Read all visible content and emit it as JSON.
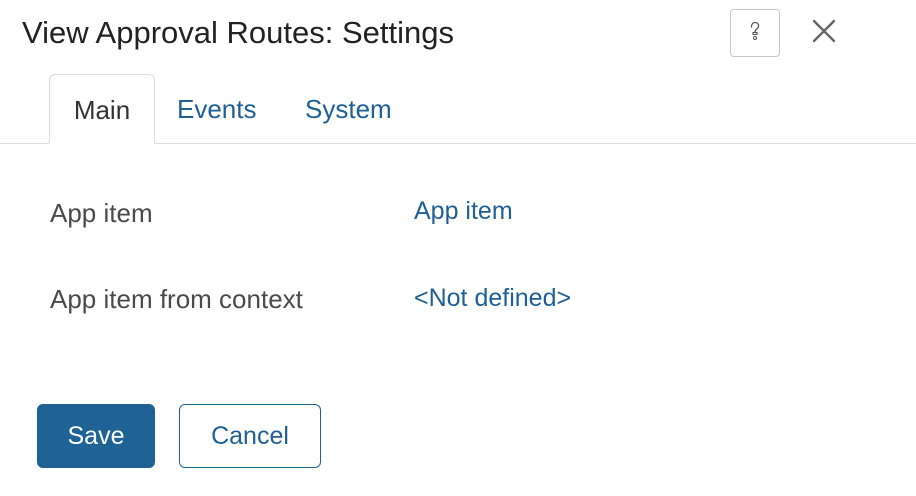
{
  "dialog": {
    "title": "View Approval Routes: Settings",
    "help_icon": "question-mark-icon",
    "close_icon": "close-icon"
  },
  "tabs": [
    {
      "label": "Main",
      "active": true
    },
    {
      "label": "Events",
      "active": false
    },
    {
      "label": "System",
      "active": false
    }
  ],
  "fields": [
    {
      "label": "App item",
      "value": "App item"
    },
    {
      "label": "App item from context",
      "value": "<Not defined>"
    }
  ],
  "buttons": {
    "save_label": "Save",
    "cancel_label": "Cancel"
  },
  "colors": {
    "accent": "#1e6394",
    "link": "#1e5f94",
    "border": "#dcdcdc"
  }
}
